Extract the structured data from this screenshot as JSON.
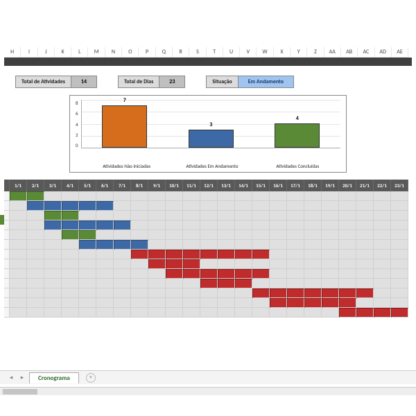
{
  "columns": [
    "H",
    "I",
    "J",
    "K",
    "L",
    "M",
    "N",
    "O",
    "P",
    "Q",
    "R",
    "S",
    "T",
    "U",
    "V",
    "W",
    "X",
    "Y",
    "Z",
    "AA",
    "AB",
    "AC",
    "AD",
    "AE"
  ],
  "summary": {
    "totalAtividadesLabel": "Total de Atividades",
    "totalAtividadesValue": "14",
    "totalDiasLabel": "Total de Dias",
    "totalDiasValue": "23",
    "situacaoLabel": "Situação",
    "situacaoValue": "Em Andamento"
  },
  "chart_data": {
    "type": "bar",
    "categories": [
      "Atividades Não Iniciadas",
      "Atividades Em Andamento",
      "Atividades Concluídas"
    ],
    "values": [
      7,
      3,
      4
    ],
    "colors": [
      "#d66d1d",
      "#3d6aa6",
      "#5a8a36"
    ],
    "ylim": [
      0,
      8
    ],
    "yticks": [
      0,
      2,
      4,
      6,
      8
    ],
    "title": "",
    "xlabel": "",
    "ylabel": ""
  },
  "gantt": {
    "dates": [
      "1/1",
      "2/1",
      "3/1",
      "4/1",
      "5/1",
      "6/1",
      "7/1",
      "8/1",
      "9/1",
      "10/1",
      "11/1",
      "12/1",
      "13/1",
      "14/1",
      "15/1",
      "16/1",
      "17/1",
      "18/1",
      "19/1",
      "20/1",
      "21/1",
      "22/1",
      "23/1"
    ],
    "rows": [
      {
        "start": 1,
        "end": 2,
        "color": "green"
      },
      {
        "start": 2,
        "end": 6,
        "color": "blue"
      },
      {
        "start": 3,
        "end": 4,
        "color": "green"
      },
      {
        "start": 3,
        "end": 7,
        "color": "blue"
      },
      {
        "start": 4,
        "end": 5,
        "color": "green"
      },
      {
        "start": 5,
        "end": 8,
        "color": "blue"
      },
      {
        "start": 8,
        "end": 15,
        "color": "red"
      },
      {
        "start": 9,
        "end": 11,
        "color": "red"
      },
      {
        "start": 10,
        "end": 15,
        "color": "red"
      },
      {
        "start": 12,
        "end": 14,
        "color": "red"
      },
      {
        "start": 15,
        "end": 21,
        "color": "red"
      },
      {
        "start": 16,
        "end": 20,
        "color": "red"
      },
      {
        "start": 20,
        "end": 23,
        "color": "red"
      }
    ]
  },
  "yaxis_ticks": [
    "8",
    "6",
    "4",
    "2",
    "0"
  ],
  "sheet": {
    "activeTab": "Cronograma"
  }
}
